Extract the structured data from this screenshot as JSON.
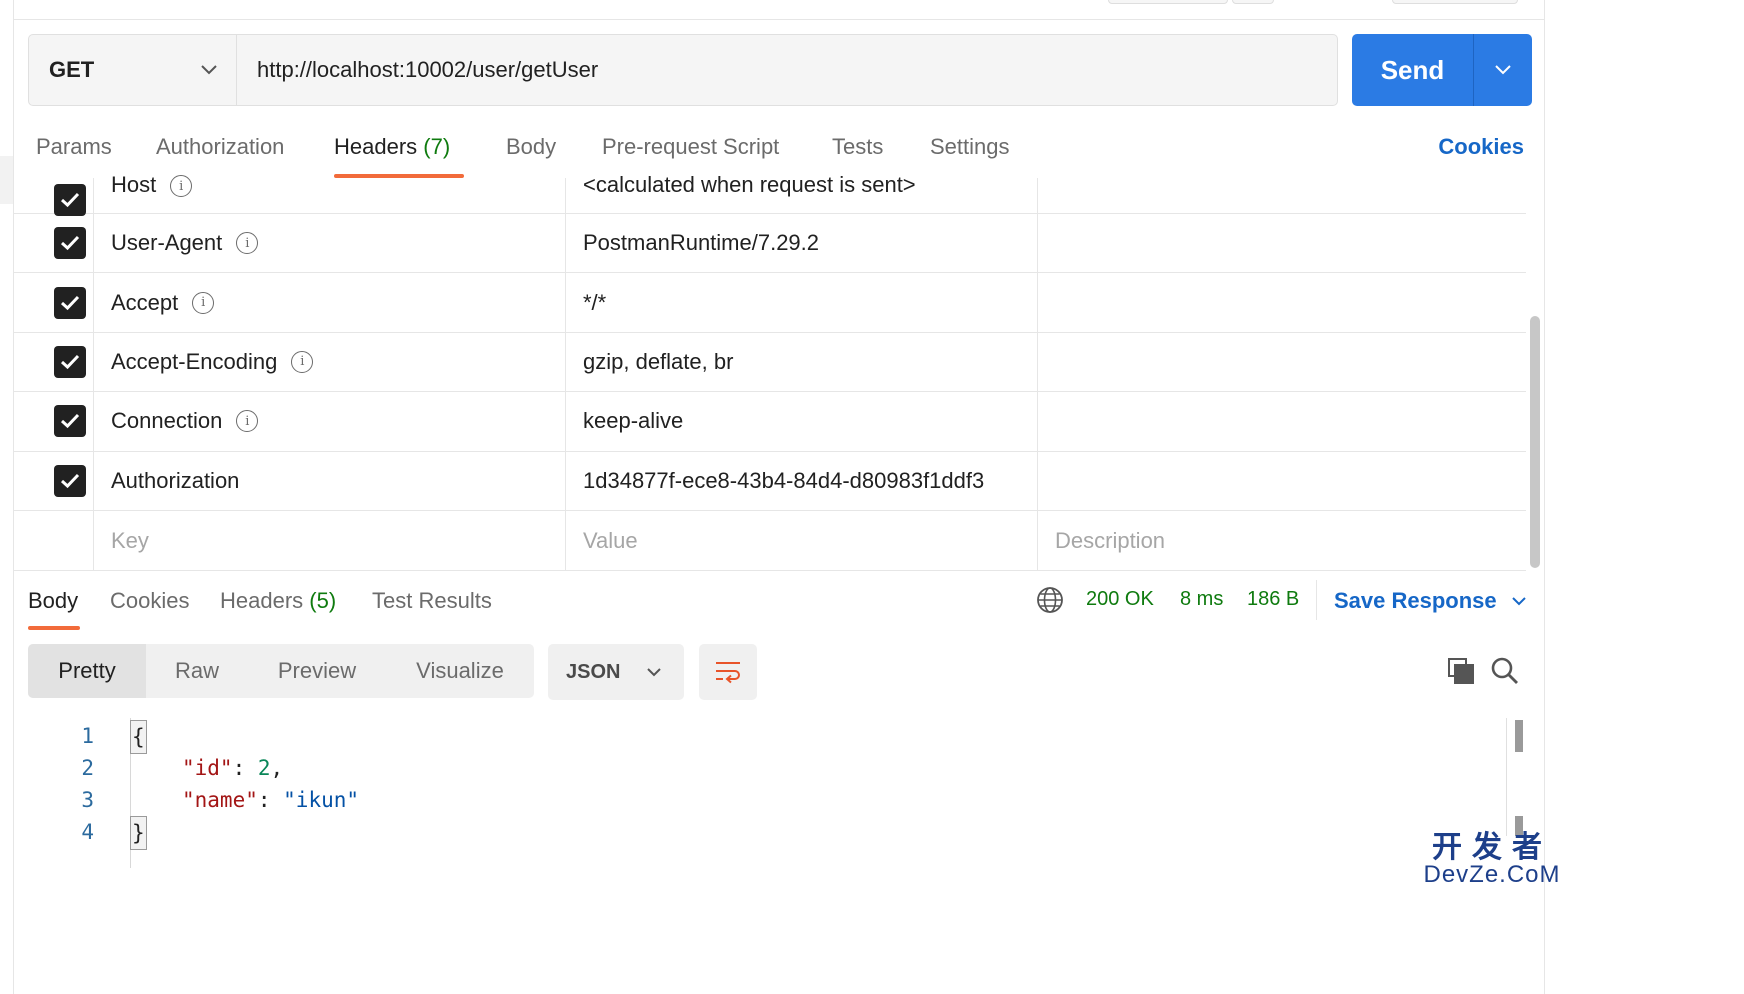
{
  "request": {
    "method": "GET",
    "url": "http://localhost:10002/user/getUser",
    "send_label": "Send"
  },
  "request_tabs": {
    "params": "Params",
    "authorization": "Authorization",
    "headers": "Headers",
    "headers_count": "(7)",
    "body": "Body",
    "prerequest": "Pre-request Script",
    "tests": "Tests",
    "settings": "Settings",
    "cookies": "Cookies"
  },
  "headers_table": {
    "rows": [
      {
        "key": "Host",
        "value": "<calculated when request is sent>",
        "checked": true,
        "info": true
      },
      {
        "key": "User-Agent",
        "value": "PostmanRuntime/7.29.2",
        "checked": true,
        "info": true
      },
      {
        "key": "Accept",
        "value": "*/*",
        "checked": true,
        "info": true
      },
      {
        "key": "Accept-Encoding",
        "value": "gzip, deflate, br",
        "checked": true,
        "info": true
      },
      {
        "key": "Connection",
        "value": "keep-alive",
        "checked": true,
        "info": true
      },
      {
        "key": "Authorization",
        "value": "1d34877f-ece8-43b4-84d4-d80983f1ddf3",
        "checked": true,
        "info": false
      }
    ],
    "placeholder": {
      "key": "Key",
      "value": "Value",
      "description": "Description"
    }
  },
  "response_tabs": {
    "body": "Body",
    "cookies": "Cookies",
    "headers": "Headers",
    "headers_count": "(5)",
    "test_results": "Test Results"
  },
  "response_meta": {
    "status": "200 OK",
    "time": "8 ms",
    "size": "186 B",
    "save_label": "Save Response"
  },
  "view_modes": {
    "pretty": "Pretty",
    "raw": "Raw",
    "preview": "Preview",
    "visualize": "Visualize",
    "format": "JSON"
  },
  "code": {
    "line_numbers": [
      "1",
      "2",
      "3",
      "4"
    ],
    "open_brace": "{",
    "close_brace": "}",
    "key_id": "\"id\"",
    "val_id": "2",
    "key_name": "\"name\"",
    "val_name": "\"ikun\""
  },
  "watermark": {
    "cn": "开发者",
    "en": "DevZe.CoM"
  },
  "colors": {
    "accent": "#2b7be4",
    "tab_underline": "#f26b3a",
    "success": "#0f7b0f",
    "link": "#1667c7"
  }
}
